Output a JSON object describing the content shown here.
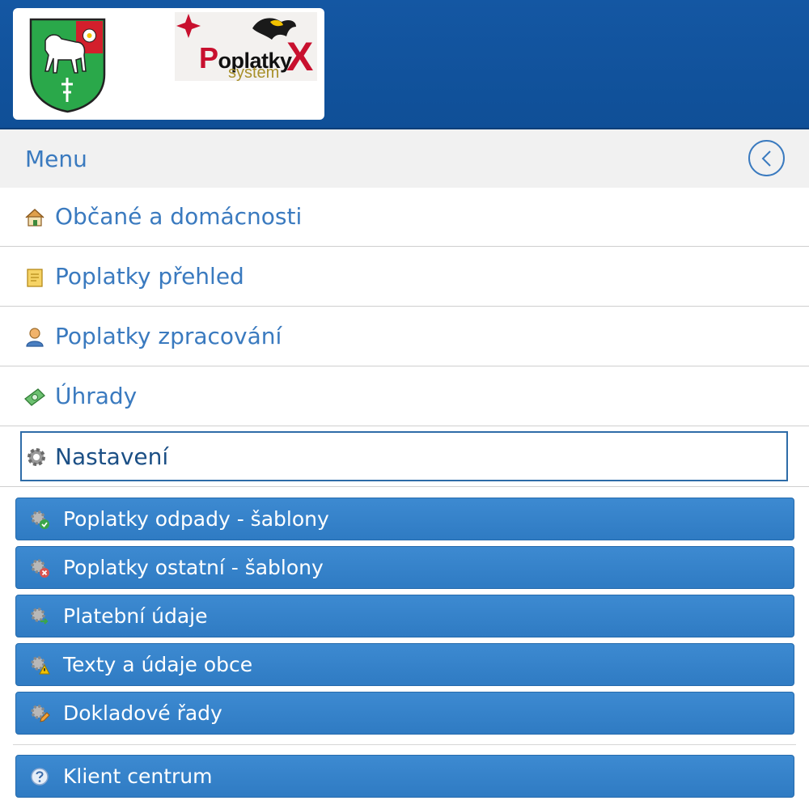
{
  "header": {
    "crest_alt": "municipal-coat-of-arms",
    "app_logo": {
      "word": "oplatky",
      "word_initial": "P",
      "sub": "system",
      "mark": "X"
    }
  },
  "menu": {
    "title": "Menu",
    "back_icon": "chevron-left-icon"
  },
  "main_items": [
    {
      "label": "Občané a domácnosti",
      "icon": "house-icon"
    },
    {
      "label": "Poplatky přehled",
      "icon": "note-icon"
    },
    {
      "label": "Poplatky zpracování",
      "icon": "user-icon"
    },
    {
      "label": "Úhrady",
      "icon": "money-icon"
    },
    {
      "label": "Nastavení",
      "icon": "gear-icon",
      "active": true
    }
  ],
  "sub_items": [
    {
      "label": "Poplatky odpady - šablony",
      "icon": "gear-check-icon"
    },
    {
      "label": "Poplatky ostatní - šablony",
      "icon": "gear-delete-icon"
    },
    {
      "label": "Platební údaje",
      "icon": "gear-arrow-icon"
    },
    {
      "label": "Texty a údaje obce",
      "icon": "gear-warning-icon"
    },
    {
      "label": "Dokladové řady",
      "icon": "gear-pencil-icon"
    }
  ],
  "footer_item": {
    "label": "Klient centrum",
    "icon": "help-icon"
  },
  "colors": {
    "header": "#1457a3",
    "accent": "#3a7abf",
    "submenu": "#3585cc"
  }
}
